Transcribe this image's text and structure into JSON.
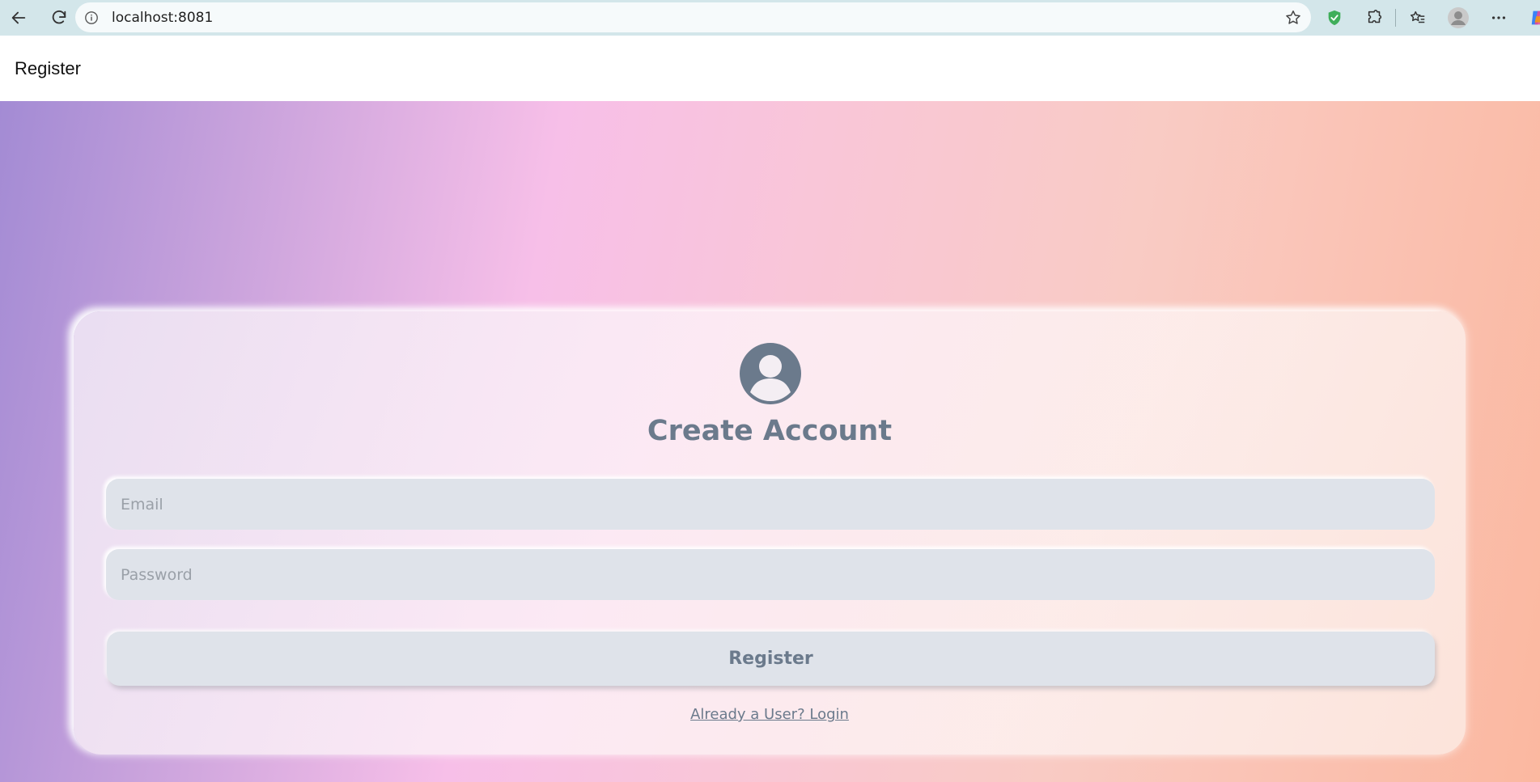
{
  "browser": {
    "url": "localhost:8081"
  },
  "page": {
    "header_title": "Register"
  },
  "form": {
    "title": "Create Account",
    "email_placeholder": "Email",
    "password_placeholder": "Password",
    "submit_label": "Register",
    "login_link": "Already a User? Login"
  },
  "colors": {
    "accent_text": "#6b7a8c",
    "field_bg": "#dfe3ea",
    "gradient_start": "#a38bd4",
    "gradient_mid": "#f7bfe8",
    "gradient_end": "#fbb8a0"
  }
}
